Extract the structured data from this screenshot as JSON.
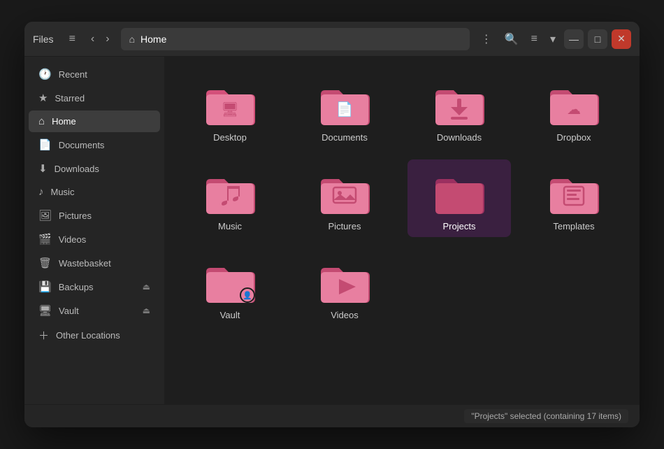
{
  "window": {
    "title": "Files",
    "location": "Home",
    "status": "\"Projects\" selected  (containing 17 items)"
  },
  "titlebar": {
    "title_label": "Files",
    "menu_icon": "≡",
    "location_label": "Home",
    "more_icon": "⋮",
    "search_icon": "🔍",
    "view_icon": "≡",
    "minimize_label": "—",
    "maximize_label": "□",
    "close_label": "✕"
  },
  "sidebar": {
    "items": [
      {
        "id": "recent",
        "label": "Recent",
        "icon": "🕐",
        "active": false
      },
      {
        "id": "starred",
        "label": "Starred",
        "icon": "★",
        "active": false
      },
      {
        "id": "home",
        "label": "Home",
        "icon": "⌂",
        "active": true
      },
      {
        "id": "documents",
        "label": "Documents",
        "icon": "📄",
        "active": false
      },
      {
        "id": "downloads",
        "label": "Downloads",
        "icon": "⬇",
        "active": false
      },
      {
        "id": "music",
        "label": "Music",
        "icon": "♪",
        "active": false
      },
      {
        "id": "pictures",
        "label": "Pictures",
        "icon": "🖼",
        "active": false
      },
      {
        "id": "videos",
        "label": "Videos",
        "icon": "🎬",
        "active": false
      },
      {
        "id": "wastebasket",
        "label": "Wastebasket",
        "icon": "🗑",
        "active": false
      },
      {
        "id": "backups",
        "label": "Backups",
        "icon": "💾",
        "eject": true,
        "active": false
      },
      {
        "id": "vault",
        "label": "Vault",
        "icon": "🖥",
        "eject": true,
        "active": false
      },
      {
        "id": "other-locations",
        "label": "Other Locations",
        "icon": "+",
        "active": false
      }
    ]
  },
  "files": [
    {
      "id": "desktop",
      "label": "Desktop",
      "symbol": "🖥",
      "selected": false
    },
    {
      "id": "documents",
      "label": "Documents",
      "symbol": "📄",
      "selected": false
    },
    {
      "id": "downloads",
      "label": "Downloads",
      "symbol": "⬇",
      "selected": false
    },
    {
      "id": "dropbox",
      "label": "Dropbox",
      "symbol": "📦",
      "selected": false
    },
    {
      "id": "music",
      "label": "Music",
      "symbol": "♪",
      "selected": false
    },
    {
      "id": "pictures",
      "label": "Pictures",
      "symbol": "🖼",
      "selected": false
    },
    {
      "id": "projects",
      "label": "Projects",
      "symbol": "",
      "selected": true
    },
    {
      "id": "templates",
      "label": "Templates",
      "symbol": "📋",
      "selected": false
    },
    {
      "id": "vault",
      "label": "Vault",
      "symbol": "🔒",
      "selected": false,
      "overlay": true
    },
    {
      "id": "videos",
      "label": "Videos",
      "symbol": "🎬",
      "selected": false
    }
  ],
  "icons": {
    "desktop": "⬛",
    "documents": "📄",
    "downloads": "⬇",
    "dropbox": "☁",
    "music": "♪",
    "pictures": "🏔",
    "projects": "",
    "templates": "📋",
    "vault": "🔒",
    "videos": "▶"
  }
}
